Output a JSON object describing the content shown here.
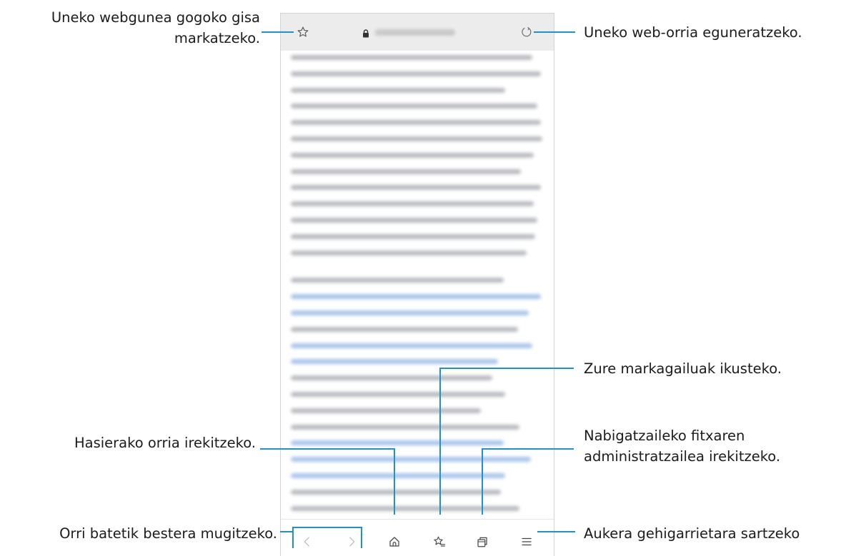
{
  "annotations": {
    "bookmark_star": [
      "Uneko webgunea gogoko gisa",
      "markatzeko."
    ],
    "refresh": "Uneko web-orria eguneratzeko.",
    "bookmarks": "Zure markagailuak ikusteko.",
    "home": "Hasierako orria irekitzeko.",
    "tabs_manager": [
      "Nabigatzaileko fitxaren",
      "administratzailea irekitzeko."
    ],
    "navigation": "Orri batetik bestera mugitzeko.",
    "menu": "Aukera gehigarrietara sartzeko"
  },
  "browser": {
    "top_bar": {
      "icons": [
        "star-outline-icon",
        "lock-icon",
        "refresh-icon"
      ]
    },
    "bottom_bar": {
      "icons": [
        "chevron-left-icon",
        "chevron-right-icon",
        "home-icon",
        "bookmarks-icon",
        "tabs-icon",
        "menu-icon"
      ]
    }
  },
  "colors": {
    "callout_line": "#1f93c9",
    "toolbar_bg": "#ececec",
    "blurred_text": "#b9bcc1",
    "blurred_link": "#a9c6ec"
  }
}
